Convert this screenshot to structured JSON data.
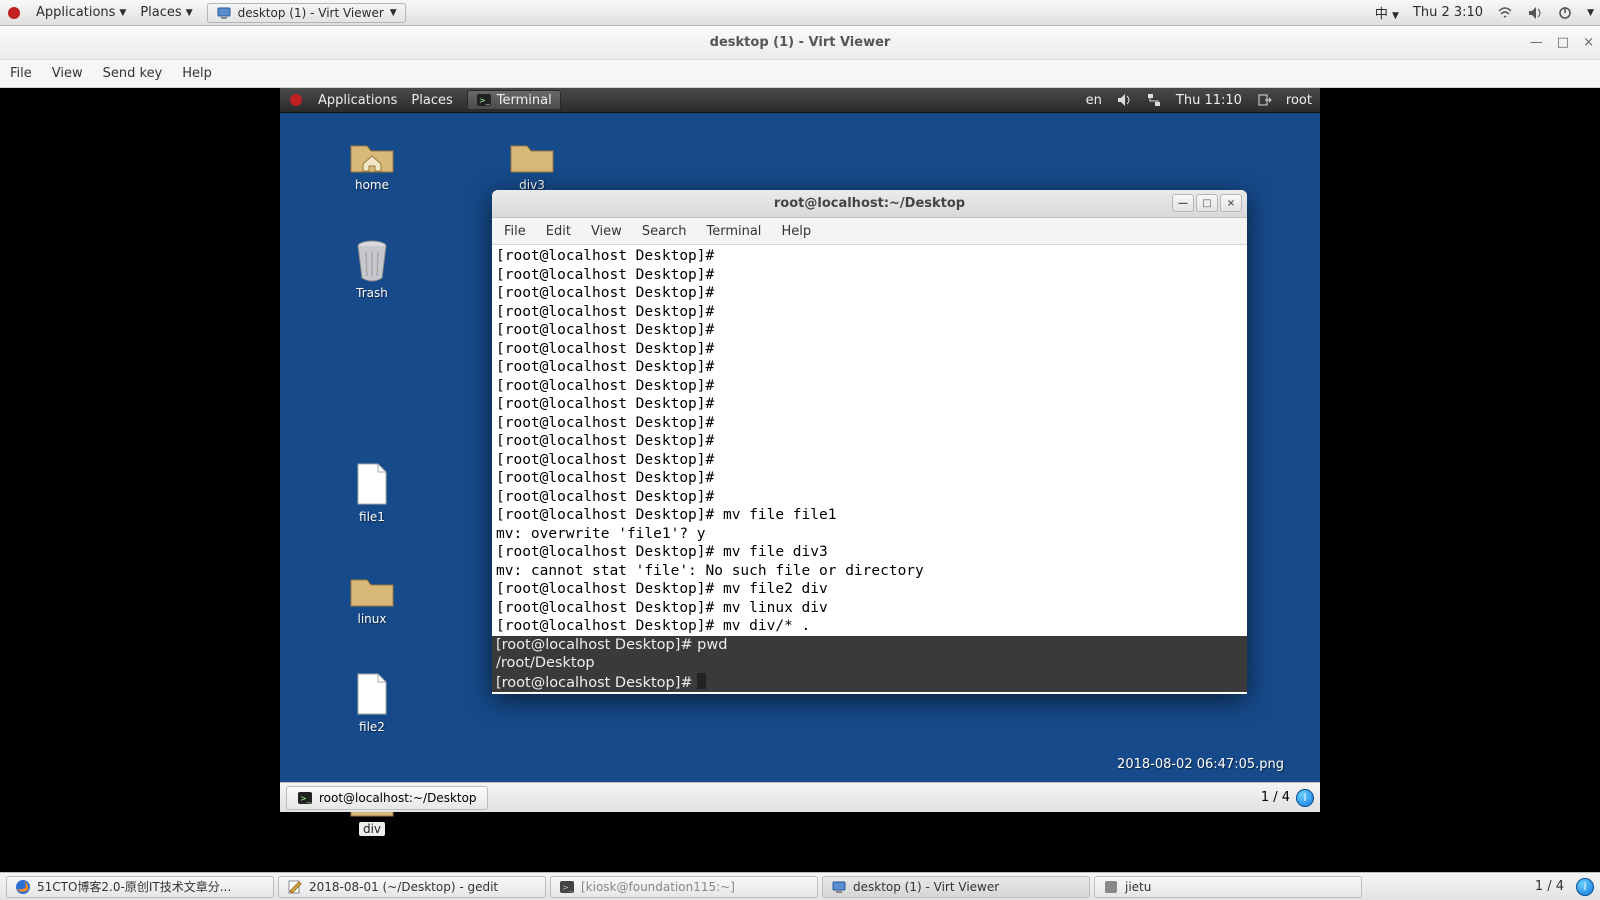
{
  "host_panel": {
    "apps": "Applications",
    "places": "Places",
    "task_vv": "desktop (1) - Virt Viewer",
    "ime": "中",
    "clock": "Thu 2 3:10"
  },
  "vv": {
    "title": "desktop (1) - Virt Viewer",
    "menu": {
      "file": "File",
      "view": "View",
      "sendkey": "Send key",
      "help": "Help"
    },
    "min": "—",
    "max": "□",
    "close": "×"
  },
  "guest_panel": {
    "apps": "Applications",
    "places": "Places",
    "terminal": "Terminal",
    "lang": "en",
    "clock": "Thu 11:10",
    "user": "root"
  },
  "desktop_icons": {
    "home": "home",
    "trash": "Trash",
    "file1": "file1",
    "linux": "linux",
    "file2": "file2",
    "div": "div",
    "div3": "div3",
    "png_name": "2018-08-02 06:47:05.png"
  },
  "terminal": {
    "title": "root@localhost:~/Desktop",
    "menu": {
      "file": "File",
      "edit": "Edit",
      "view": "View",
      "search": "Search",
      "terminal": "Terminal",
      "help": "Help"
    },
    "btn_min": "—",
    "btn_max": "□",
    "btn_close": "×",
    "lines": [
      "[root@localhost Desktop]#",
      "[root@localhost Desktop]#",
      "[root@localhost Desktop]#",
      "[root@localhost Desktop]#",
      "[root@localhost Desktop]#",
      "[root@localhost Desktop]#",
      "[root@localhost Desktop]#",
      "[root@localhost Desktop]#",
      "[root@localhost Desktop]#",
      "[root@localhost Desktop]#",
      "[root@localhost Desktop]#",
      "[root@localhost Desktop]#",
      "[root@localhost Desktop]#",
      "[root@localhost Desktop]#",
      "[root@localhost Desktop]# mv file file1",
      "mv: overwrite 'file1'? y",
      "[root@localhost Desktop]# mv file div3",
      "mv: cannot stat 'file': No such file or directory",
      "[root@localhost Desktop]# mv file2 div",
      "[root@localhost Desktop]# mv linux div",
      "[root@localhost Desktop]# mv div/* ."
    ],
    "hl_lines": [
      "[root@localhost Desktop]# pwd",
      "/root/Desktop",
      "[root@localhost Desktop]# "
    ]
  },
  "guest_taskbar": {
    "terminal": "root@localhost:~/Desktop",
    "wscount": "1 / 4"
  },
  "host_taskbar": {
    "items": [
      "51CTO博客2.0-原创IT技术文章分...",
      "2018-08-01 (~/Desktop) - gedit",
      "[kiosk@foundation115:~]",
      "desktop (1) - Virt Viewer",
      "jietu"
    ],
    "wscount": "1 / 4"
  }
}
